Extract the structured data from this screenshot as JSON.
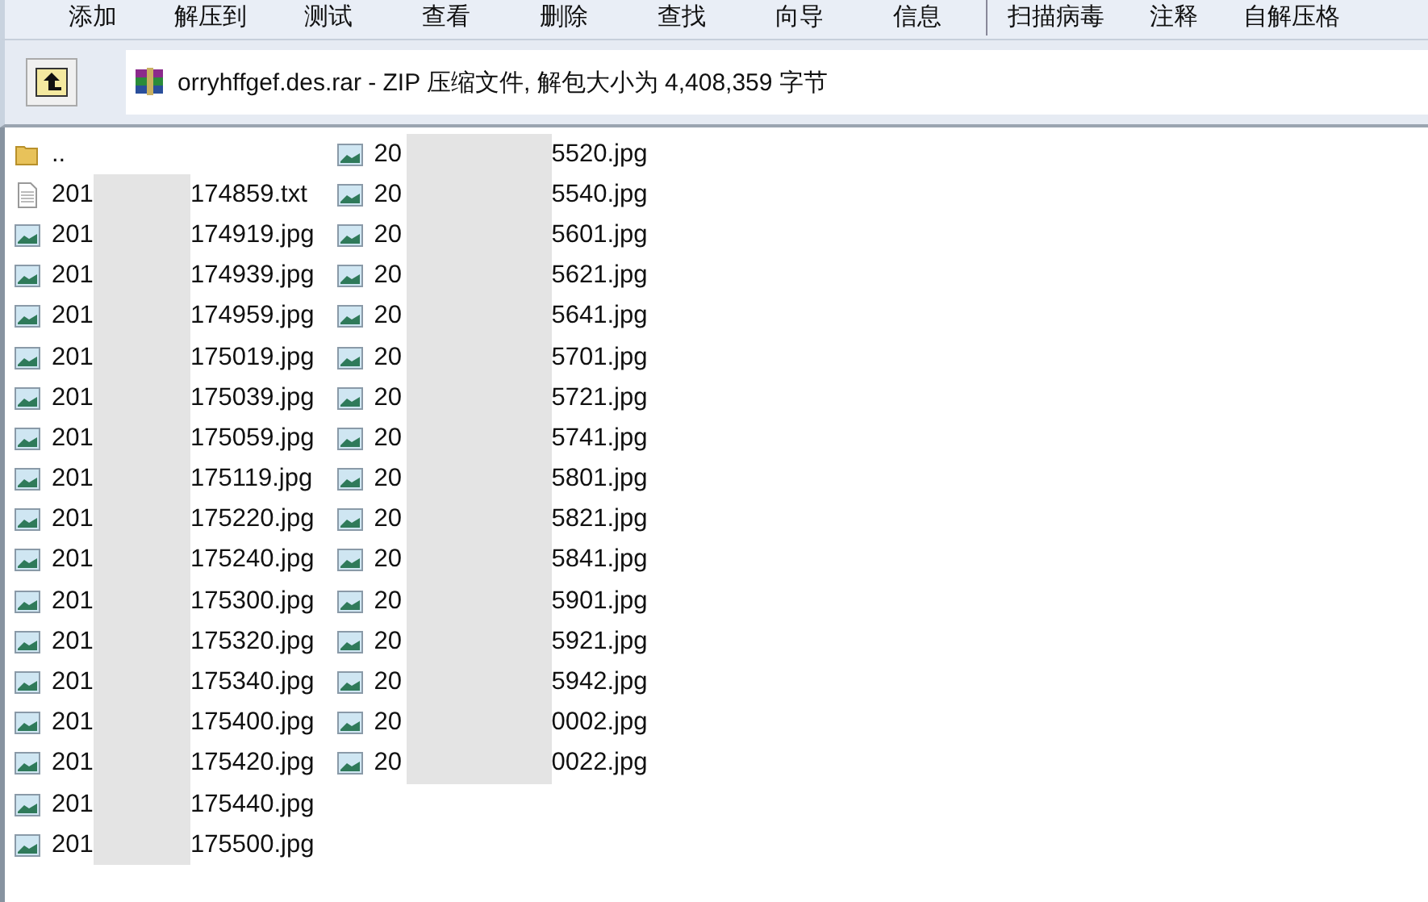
{
  "toolbar": [
    {
      "kind": "button",
      "label": "添加"
    },
    {
      "kind": "button",
      "label": "解压到"
    },
    {
      "kind": "button",
      "label": "测试"
    },
    {
      "kind": "button",
      "label": "查看"
    },
    {
      "kind": "button",
      "label": "删除"
    },
    {
      "kind": "button",
      "label": "查找"
    },
    {
      "kind": "button",
      "label": "向导"
    },
    {
      "kind": "button",
      "label": "信息"
    },
    {
      "kind": "separator"
    },
    {
      "kind": "button",
      "label": "扫描病毒"
    },
    {
      "kind": "button",
      "label": "注释"
    },
    {
      "kind": "button",
      "label": "自解压格"
    }
  ],
  "address_bar": {
    "path": "orryhffgef.des.rar - ZIP 压缩文件, 解包大小为 4,408,359 字节"
  },
  "file_columns": [
    {
      "files": [
        {
          "kind": "folder",
          "name_start": ".."
        },
        {
          "kind": "text",
          "name_start": "201",
          "name_end": "174859.txt"
        },
        {
          "kind": "image",
          "name_start": "201",
          "name_end": "174919.jpg"
        },
        {
          "kind": "image",
          "name_start": "201",
          "name_end": "174939.jpg"
        },
        {
          "kind": "image",
          "name_start": "201",
          "name_end": "174959.jpg"
        },
        {
          "kind": "image",
          "name_start": "201",
          "name_end": "175019.jpg"
        },
        {
          "kind": "image",
          "name_start": "201",
          "name_end": "175039.jpg"
        },
        {
          "kind": "image",
          "name_start": "201",
          "name_end": "175059.jpg"
        },
        {
          "kind": "image",
          "name_start": "201",
          "name_end": "175119.jpg"
        },
        {
          "kind": "image",
          "name_start": "201",
          "name_end": "175220.jpg"
        },
        {
          "kind": "image",
          "name_start": "201",
          "name_end": "175240.jpg"
        },
        {
          "kind": "image",
          "name_start": "201",
          "name_end": "175300.jpg"
        },
        {
          "kind": "image",
          "name_start": "201",
          "name_end": "175320.jpg"
        },
        {
          "kind": "image",
          "name_start": "201",
          "name_end": "175340.jpg"
        },
        {
          "kind": "image",
          "name_start": "201",
          "name_end": "175400.jpg"
        },
        {
          "kind": "image",
          "name_start": "201",
          "name_end": "175420.jpg"
        },
        {
          "kind": "image",
          "name_start": "201",
          "name_end": "175440.jpg"
        },
        {
          "kind": "image",
          "name_start": "201",
          "name_end": "175500.jpg"
        }
      ]
    },
    {
      "files": [
        {
          "kind": "image",
          "name_start": "20",
          "name_end": "5520.jpg"
        },
        {
          "kind": "image",
          "name_start": "20",
          "name_end": "5540.jpg"
        },
        {
          "kind": "image",
          "name_start": "20",
          "name_end": "5601.jpg"
        },
        {
          "kind": "image",
          "name_start": "20",
          "name_end": "5621.jpg"
        },
        {
          "kind": "image",
          "name_start": "20",
          "name_end": "5641.jpg"
        },
        {
          "kind": "image",
          "name_start": "20",
          "name_end": "5701.jpg"
        },
        {
          "kind": "image",
          "name_start": "20",
          "name_end": "5721.jpg"
        },
        {
          "kind": "image",
          "name_start": "20",
          "name_end": "5741.jpg"
        },
        {
          "kind": "image",
          "name_start": "20",
          "name_end": "5801.jpg"
        },
        {
          "kind": "image",
          "name_start": "20",
          "name_end": "5821.jpg"
        },
        {
          "kind": "image",
          "name_start": "20",
          "name_end": "5841.jpg"
        },
        {
          "kind": "image",
          "name_start": "20",
          "name_end": "5901.jpg"
        },
        {
          "kind": "image",
          "name_start": "20",
          "name_end": "5921.jpg"
        },
        {
          "kind": "image",
          "name_start": "20",
          "name_end": "5942.jpg"
        },
        {
          "kind": "image",
          "name_start": "20",
          "name_end": "0002.jpg"
        },
        {
          "kind": "image",
          "name_start": "20",
          "name_end": "0022.jpg"
        }
      ]
    }
  ]
}
